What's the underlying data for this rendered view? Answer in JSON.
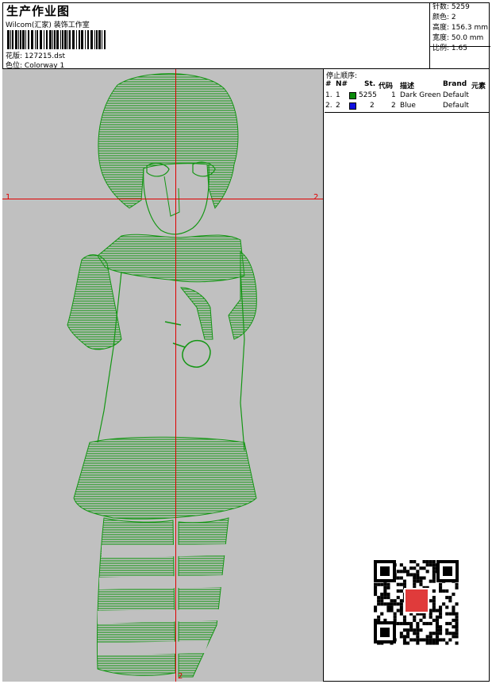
{
  "header": {
    "title": "生产作业图",
    "subtitle": "Wilcom(汇家) 装饰工作室",
    "design_label": "花版:",
    "design_value": "127215.dst",
    "color_label": "色位:",
    "color_value": "Colorway 1"
  },
  "stats": {
    "stitches": "针数: 5259",
    "colors": "颜色: 2",
    "height": "高度: 156.3 mm",
    "width": "宽度: 50.0 mm",
    "scale": "比例: 1.65"
  },
  "canvas": {
    "axis_labels": {
      "left_h": "1",
      "right_h": "2",
      "bottom_v": "2"
    },
    "stitch_color": "#149614",
    "background": "#c0c0c0"
  },
  "sequence": {
    "title": "停止顺序:",
    "columns": [
      "#",
      "N#",
      "St.",
      "代码",
      "描述",
      "Brand",
      "元素"
    ],
    "rows": [
      {
        "num": "1.",
        "n": "1",
        "color": "#0a8a0a",
        "stitches": "5255",
        "code": "1",
        "desc": "Dark Green",
        "brand": "Default"
      },
      {
        "num": "2.",
        "n": "2",
        "color": "#1010e0",
        "stitches": "2",
        "code": "2",
        "desc": "Blue",
        "brand": "Default"
      }
    ]
  },
  "watermark": {
    "stamp_text": "以图 绣版"
  }
}
